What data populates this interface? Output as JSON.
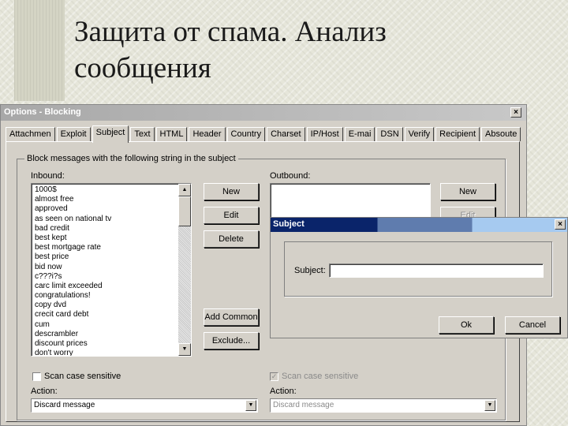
{
  "slide": {
    "title_line1": "Защита от спама. Анализ",
    "title_line2": "сообщения"
  },
  "window": {
    "title": "Options - Blocking",
    "close_glyph": "×",
    "tabs": [
      "Attachmen",
      "Exploit",
      "Subject",
      "Text",
      "HTML",
      "Header",
      "Country",
      "Charset",
      "IP/Host",
      "E-mai",
      "DSN",
      "Verify",
      "Recipient",
      "Absoute"
    ],
    "active_tab": "Subject",
    "group_label": "Block messages with the following string in the subject",
    "inbound": {
      "label": "Inbound:",
      "items": [
        "1000$",
        "almost free",
        "approved",
        "as seen on national tv",
        "bad credit",
        "best kept",
        "best mortgage rate",
        "best price",
        "bid now",
        "c???i?s",
        "carc limit exceeded",
        "congratulations!",
        "copy dvd",
        "crecit card debt",
        "cum",
        "descrambler",
        "discount prices",
        "don't worry"
      ],
      "scroll_up": "▲",
      "scroll_down": "▼",
      "buttons": {
        "new": "New",
        "edit": "Edit",
        "delete": "Delete",
        "add_common": "Add Common",
        "exclude": "Exclude..."
      },
      "case_sensitive_label": "Scan case sensitive",
      "case_sensitive_checked": false,
      "action_label": "Action:",
      "action_value": "Discard message",
      "combo_arrow": "▼"
    },
    "outbound": {
      "label": "Outbound:",
      "buttons": {
        "new": "New",
        "edit": "Edit"
      },
      "case_sensitive_label": "Scan case sensitive",
      "case_sensitive_checked": true,
      "check_glyph": "✓",
      "action_label": "Action:",
      "action_value": "Discard message",
      "combo_arrow": "▼"
    }
  },
  "dialog": {
    "title": "Subject",
    "close_glyph": "×",
    "subject_label": "Subject:",
    "subject_value": "",
    "ok_label": "Ok",
    "cancel_label": "Cancel"
  }
}
